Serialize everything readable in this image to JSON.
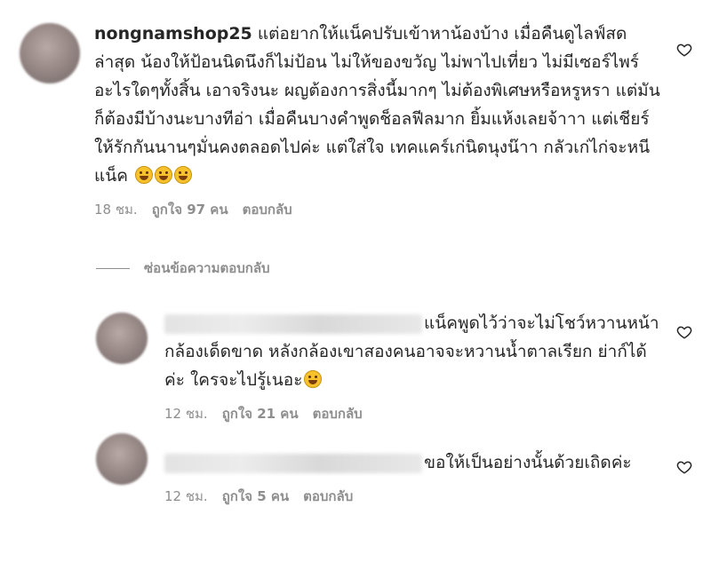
{
  "comments": [
    {
      "username": "nongnamshop25",
      "text": "แต่อยากให้แน็คปรับเข้าหาน้องบ้าง เมื่อคืนดูไลฟ์สดล่าสุด น้องให้ป้อนนิดนึงก็ไม่ป้อน ไม่ให้ของขวัญ ไม่พาไปเที่ยว ไม่มีเซอร์ไพร์อะไรใดๆทั้งสิ้น เอาจริงนะ ผญต้องการสิ่งนี้มากๆ ไม่ต้องพิเศษหรือหรูหรา แต่มันก็ต้องมีบ้างนะบางทีอ่า เมื่อคืนบางคำพูดช็อลฟีลมาก ยิ้มแห้งเลยจ้าาา แต่เชียร์ให้รักกันนานๆมั่นคงตลอดไปค่ะ แต่ใส่ใจ เทคแคร์เก่นิดนุงน๊าา กลัวเก่ไก่จะหนีแน็ค",
      "emojis": [
        "rofl-emoji",
        "rofl-emoji",
        "rofl-emoji"
      ],
      "time": "18 ชม.",
      "likes": "ถูกใจ 97 คน",
      "reply_label": "ตอบกลับ"
    }
  ],
  "hide_replies_label": "ซ่อนข้อความตอบกลับ",
  "replies": [
    {
      "text": "แน็คพูดไว้ว่าจะไม่โชว์หวานหน้ากล้องเด็ดขาด หลังกล้องเขาสองคนอาจจะหวานน้ำตาลเรียก ย่าก์ได้ค่ะ ใครจะไปรู้เนอะ",
      "emojis": [
        "grinning-sweat-emoji"
      ],
      "time": "12 ชม.",
      "likes": "ถูกใจ 21 คน",
      "reply_label": "ตอบกลับ"
    },
    {
      "text": "ขอให้เป็นอย่างนั้นด้วยเถิดค่ะ",
      "emojis": [],
      "time": "12 ชม.",
      "likes": "ถูกใจ 5 คน",
      "reply_label": "ตอบกลับ"
    }
  ],
  "icons": {
    "like": "heart-outline-icon"
  },
  "colors": {
    "text": "#262626",
    "meta": "#8e8e8e"
  }
}
